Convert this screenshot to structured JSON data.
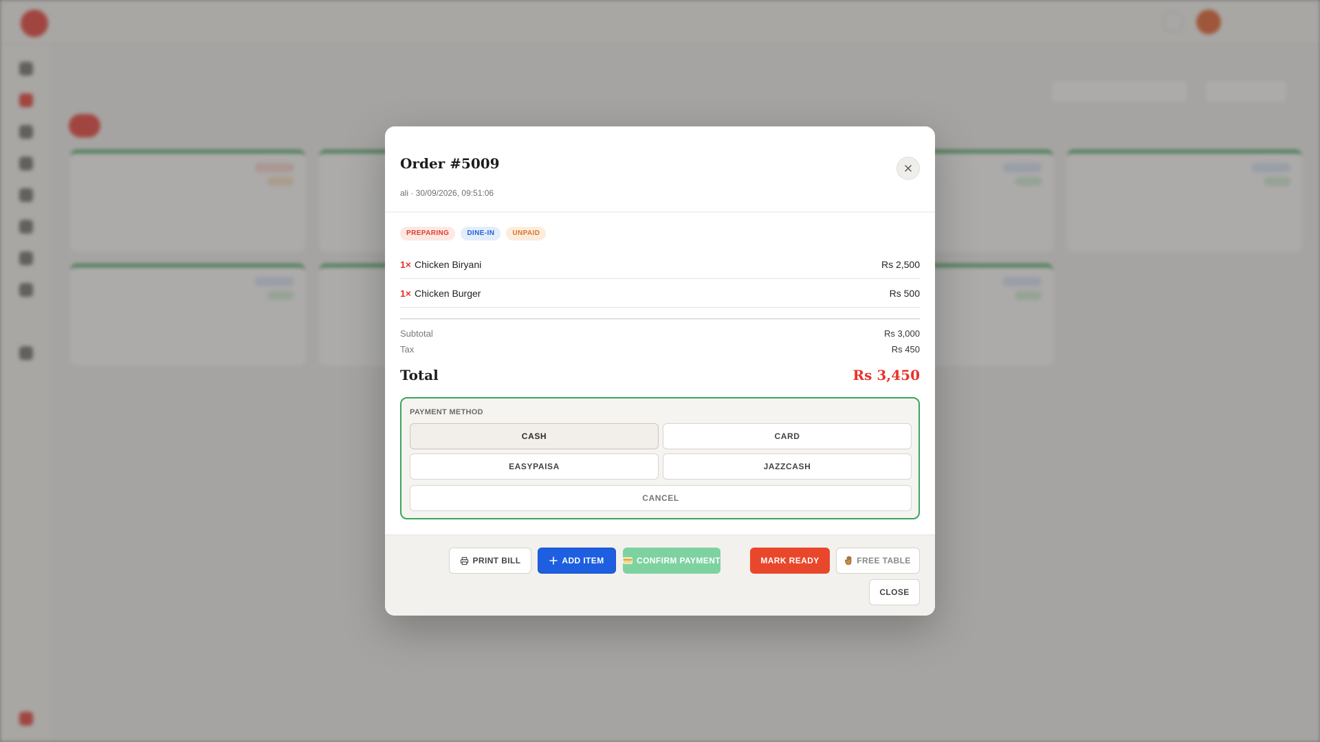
{
  "modal": {
    "title": "Order #5009",
    "subtitle": "ali · 30/09/2026, 09:51:06",
    "badges": [
      {
        "label": "PREPARING",
        "color": "#d8402c"
      },
      {
        "label": "DINE-IN",
        "color": "#1e63d6"
      },
      {
        "label": "UNPAID",
        "color": "#d8772c"
      }
    ],
    "items": [
      {
        "qty": "1×",
        "name": "Chicken Biryani",
        "price": "Rs 2,500"
      },
      {
        "qty": "1×",
        "name": "Chicken Burger",
        "price": "Rs 500"
      }
    ],
    "summary": {
      "subtotal_label": "Subtotal",
      "subtotal_value": "Rs 3,000",
      "tax_label": "Tax",
      "tax_value": "Rs 450",
      "total_label": "Total",
      "total_value": "Rs 3,450"
    },
    "payment": {
      "label": "PAYMENT METHOD",
      "options": [
        "CASH",
        "CARD",
        "EASYPAISA",
        "JAZZCASH"
      ],
      "selected": "CASH",
      "cancel_label": "CANCEL"
    },
    "footer": {
      "print_bill": "PRINT BILL",
      "add_item": "ADD ITEM",
      "confirm_payment": "CONFIRM PAYMENT",
      "mark_ready": "MARK READY",
      "free_table": "FREE TABLE",
      "close": "CLOSE"
    }
  },
  "colors": {
    "accent": "#e9332a",
    "primary_blue": "#1d5fe0",
    "success_green": "#3aa55b",
    "confirm_green": "#7ed2a0"
  }
}
